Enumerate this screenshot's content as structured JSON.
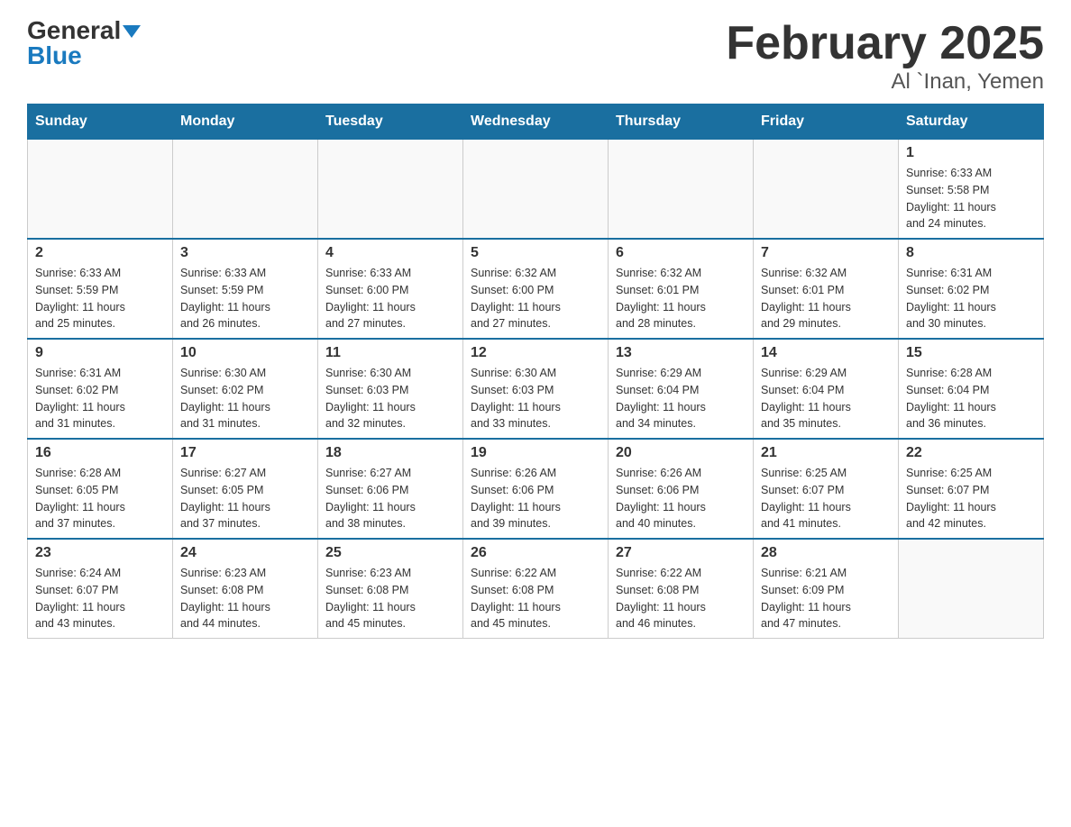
{
  "header": {
    "logo_general": "General",
    "logo_blue": "Blue",
    "title": "February 2025",
    "subtitle": "Al `Inan, Yemen"
  },
  "days_of_week": [
    "Sunday",
    "Monday",
    "Tuesday",
    "Wednesday",
    "Thursday",
    "Friday",
    "Saturday"
  ],
  "weeks": [
    [
      {
        "day": "",
        "info": ""
      },
      {
        "day": "",
        "info": ""
      },
      {
        "day": "",
        "info": ""
      },
      {
        "day": "",
        "info": ""
      },
      {
        "day": "",
        "info": ""
      },
      {
        "day": "",
        "info": ""
      },
      {
        "day": "1",
        "info": "Sunrise: 6:33 AM\nSunset: 5:58 PM\nDaylight: 11 hours\nand 24 minutes."
      }
    ],
    [
      {
        "day": "2",
        "info": "Sunrise: 6:33 AM\nSunset: 5:59 PM\nDaylight: 11 hours\nand 25 minutes."
      },
      {
        "day": "3",
        "info": "Sunrise: 6:33 AM\nSunset: 5:59 PM\nDaylight: 11 hours\nand 26 minutes."
      },
      {
        "day": "4",
        "info": "Sunrise: 6:33 AM\nSunset: 6:00 PM\nDaylight: 11 hours\nand 27 minutes."
      },
      {
        "day": "5",
        "info": "Sunrise: 6:32 AM\nSunset: 6:00 PM\nDaylight: 11 hours\nand 27 minutes."
      },
      {
        "day": "6",
        "info": "Sunrise: 6:32 AM\nSunset: 6:01 PM\nDaylight: 11 hours\nand 28 minutes."
      },
      {
        "day": "7",
        "info": "Sunrise: 6:32 AM\nSunset: 6:01 PM\nDaylight: 11 hours\nand 29 minutes."
      },
      {
        "day": "8",
        "info": "Sunrise: 6:31 AM\nSunset: 6:02 PM\nDaylight: 11 hours\nand 30 minutes."
      }
    ],
    [
      {
        "day": "9",
        "info": "Sunrise: 6:31 AM\nSunset: 6:02 PM\nDaylight: 11 hours\nand 31 minutes."
      },
      {
        "day": "10",
        "info": "Sunrise: 6:30 AM\nSunset: 6:02 PM\nDaylight: 11 hours\nand 31 minutes."
      },
      {
        "day": "11",
        "info": "Sunrise: 6:30 AM\nSunset: 6:03 PM\nDaylight: 11 hours\nand 32 minutes."
      },
      {
        "day": "12",
        "info": "Sunrise: 6:30 AM\nSunset: 6:03 PM\nDaylight: 11 hours\nand 33 minutes."
      },
      {
        "day": "13",
        "info": "Sunrise: 6:29 AM\nSunset: 6:04 PM\nDaylight: 11 hours\nand 34 minutes."
      },
      {
        "day": "14",
        "info": "Sunrise: 6:29 AM\nSunset: 6:04 PM\nDaylight: 11 hours\nand 35 minutes."
      },
      {
        "day": "15",
        "info": "Sunrise: 6:28 AM\nSunset: 6:04 PM\nDaylight: 11 hours\nand 36 minutes."
      }
    ],
    [
      {
        "day": "16",
        "info": "Sunrise: 6:28 AM\nSunset: 6:05 PM\nDaylight: 11 hours\nand 37 minutes."
      },
      {
        "day": "17",
        "info": "Sunrise: 6:27 AM\nSunset: 6:05 PM\nDaylight: 11 hours\nand 37 minutes."
      },
      {
        "day": "18",
        "info": "Sunrise: 6:27 AM\nSunset: 6:06 PM\nDaylight: 11 hours\nand 38 minutes."
      },
      {
        "day": "19",
        "info": "Sunrise: 6:26 AM\nSunset: 6:06 PM\nDaylight: 11 hours\nand 39 minutes."
      },
      {
        "day": "20",
        "info": "Sunrise: 6:26 AM\nSunset: 6:06 PM\nDaylight: 11 hours\nand 40 minutes."
      },
      {
        "day": "21",
        "info": "Sunrise: 6:25 AM\nSunset: 6:07 PM\nDaylight: 11 hours\nand 41 minutes."
      },
      {
        "day": "22",
        "info": "Sunrise: 6:25 AM\nSunset: 6:07 PM\nDaylight: 11 hours\nand 42 minutes."
      }
    ],
    [
      {
        "day": "23",
        "info": "Sunrise: 6:24 AM\nSunset: 6:07 PM\nDaylight: 11 hours\nand 43 minutes."
      },
      {
        "day": "24",
        "info": "Sunrise: 6:23 AM\nSunset: 6:08 PM\nDaylight: 11 hours\nand 44 minutes."
      },
      {
        "day": "25",
        "info": "Sunrise: 6:23 AM\nSunset: 6:08 PM\nDaylight: 11 hours\nand 45 minutes."
      },
      {
        "day": "26",
        "info": "Sunrise: 6:22 AM\nSunset: 6:08 PM\nDaylight: 11 hours\nand 45 minutes."
      },
      {
        "day": "27",
        "info": "Sunrise: 6:22 AM\nSunset: 6:08 PM\nDaylight: 11 hours\nand 46 minutes."
      },
      {
        "day": "28",
        "info": "Sunrise: 6:21 AM\nSunset: 6:09 PM\nDaylight: 11 hours\nand 47 minutes."
      },
      {
        "day": "",
        "info": ""
      }
    ]
  ]
}
